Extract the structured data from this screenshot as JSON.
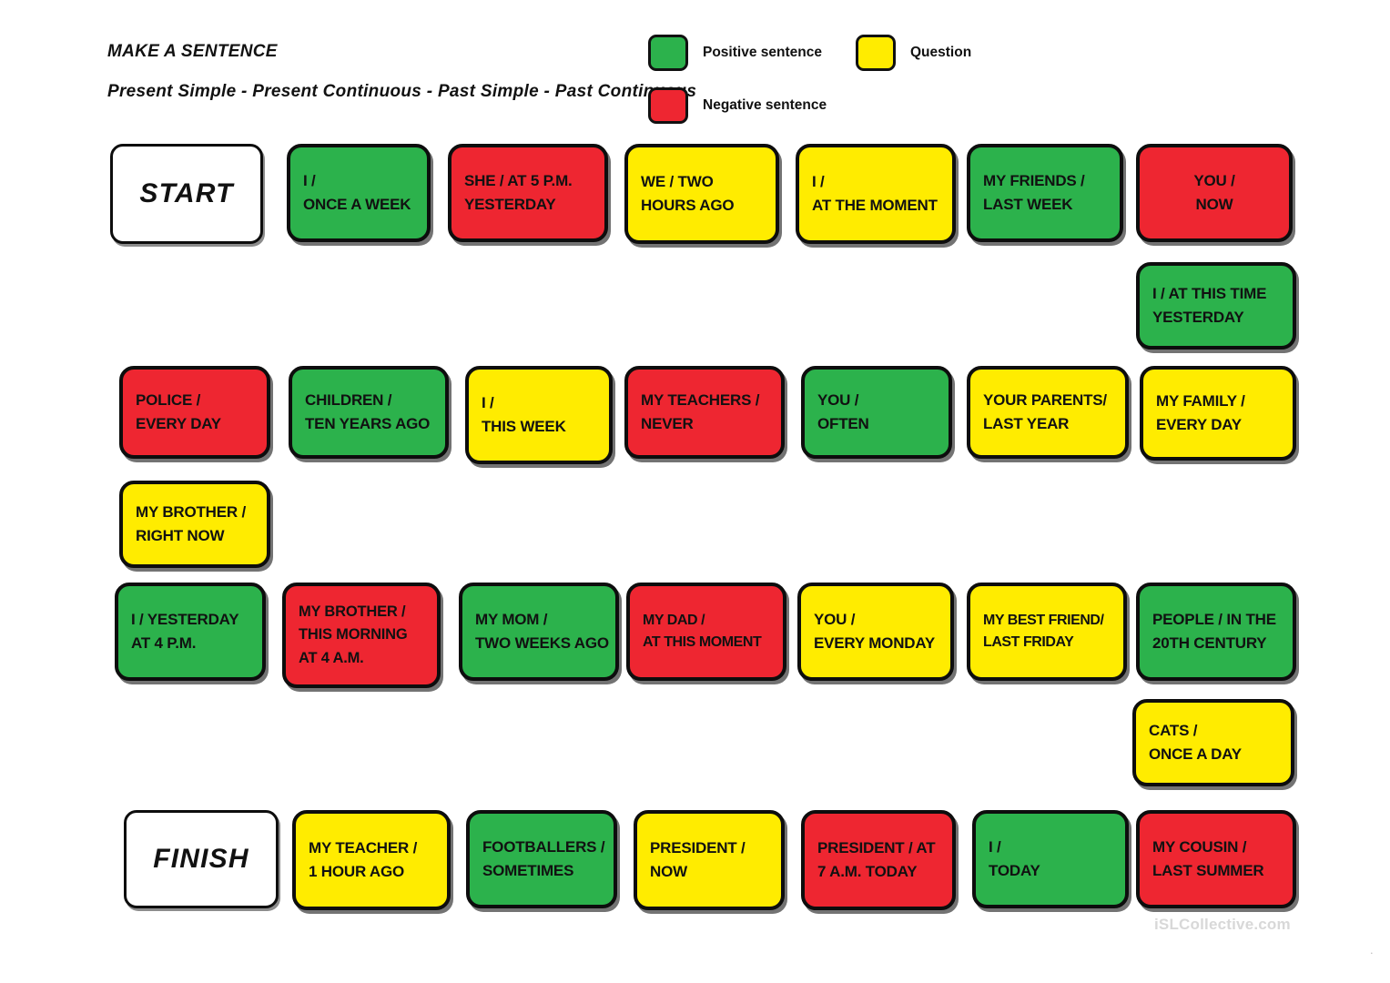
{
  "header": {
    "title": "MAKE A SENTENCE",
    "subtitle": "Present Simple - Present Continuous - Past Simple - Past Continuous"
  },
  "legend": {
    "positive": {
      "label": "Positive sentence",
      "color": "#2cb24c"
    },
    "negative": {
      "label": "Negative sentence",
      "color": "#ee2631"
    },
    "question": {
      "label": "Question",
      "color": "#ffec00"
    }
  },
  "colors": {
    "green": "#2cb24c",
    "red": "#ee2631",
    "yellow": "#ffec00",
    "white": "#ffffff",
    "outline": "#0d0d0d",
    "watermark": "#d8d8d8"
  },
  "board": {
    "cards": [
      {
        "id": "start",
        "type": "white",
        "lines": [
          "START"
        ]
      },
      {
        "id": "r1c2",
        "type": "green",
        "lines": [
          "I /",
          "ONCE A WEEK"
        ]
      },
      {
        "id": "r1c3",
        "type": "red",
        "lines": [
          "SHE / AT 5 P.M.",
          "YESTERDAY"
        ]
      },
      {
        "id": "r1c4",
        "type": "yellow",
        "lines": [
          "WE / TWO",
          "HOURS AGO"
        ]
      },
      {
        "id": "r1c5",
        "type": "yellow",
        "lines": [
          "I /",
          "AT THE MOMENT"
        ]
      },
      {
        "id": "r1c6",
        "type": "green",
        "lines": [
          "MY FRIENDS /",
          "LAST WEEK"
        ]
      },
      {
        "id": "r1c7",
        "type": "red",
        "lines": [
          "YOU /",
          "NOW"
        ]
      },
      {
        "id": "link1",
        "type": "green",
        "lines": [
          "I / AT THIS TIME",
          "YESTERDAY"
        ]
      },
      {
        "id": "r2c1",
        "type": "red",
        "lines": [
          "POLICE /",
          "EVERY DAY"
        ]
      },
      {
        "id": "r2c2",
        "type": "green",
        "lines": [
          "CHILDREN /",
          "TEN YEARS AGO"
        ]
      },
      {
        "id": "r2c3",
        "type": "yellow",
        "lines": [
          "I /",
          "THIS WEEK"
        ]
      },
      {
        "id": "r2c4",
        "type": "red",
        "lines": [
          "MY TEACHERS /",
          "NEVER"
        ]
      },
      {
        "id": "r2c5",
        "type": "green",
        "lines": [
          "YOU /",
          "OFTEN"
        ]
      },
      {
        "id": "r2c6",
        "type": "yellow",
        "lines": [
          "YOUR PARENTS/",
          "LAST YEAR"
        ]
      },
      {
        "id": "r2c7",
        "type": "yellow",
        "lines": [
          "MY FAMILY /",
          "EVERY DAY"
        ]
      },
      {
        "id": "link2",
        "type": "yellow",
        "lines": [
          "MY BROTHER /",
          "RIGHT NOW"
        ]
      },
      {
        "id": "r3c1",
        "type": "green",
        "lines": [
          "I / YESTERDAY",
          "AT 4 P.M."
        ]
      },
      {
        "id": "r3c2",
        "type": "red",
        "lines": [
          "MY BROTHER /",
          "THIS MORNING",
          "AT 4 A.M."
        ]
      },
      {
        "id": "r3c3",
        "type": "green",
        "lines": [
          "MY MOM /",
          "TWO WEEKS AGO"
        ]
      },
      {
        "id": "r3c4",
        "type": "red",
        "lines": [
          "MY DAD /",
          "AT THIS MOMENT"
        ]
      },
      {
        "id": "r3c5",
        "type": "yellow",
        "lines": [
          "YOU /",
          "EVERY MONDAY"
        ]
      },
      {
        "id": "r3c6",
        "type": "yellow",
        "lines": [
          "MY BEST FRIEND/",
          "LAST FRIDAY"
        ]
      },
      {
        "id": "r3c7",
        "type": "green",
        "lines": [
          "PEOPLE / IN THE",
          "20TH CENTURY"
        ]
      },
      {
        "id": "link3",
        "type": "yellow",
        "lines": [
          "CATS /",
          "ONCE A DAY"
        ]
      },
      {
        "id": "finish",
        "type": "white",
        "lines": [
          "FINISH"
        ]
      },
      {
        "id": "r4c2",
        "type": "yellow",
        "lines": [
          "MY TEACHER /",
          "1 HOUR AGO"
        ]
      },
      {
        "id": "r4c3",
        "type": "green",
        "lines": [
          "FOOTBALLERS /",
          "SOMETIMES"
        ]
      },
      {
        "id": "r4c4",
        "type": "yellow",
        "lines": [
          "PRESIDENT /",
          "NOW"
        ]
      },
      {
        "id": "r4c5",
        "type": "red",
        "lines": [
          "PRESIDENT / AT",
          "7 A.M. TODAY"
        ]
      },
      {
        "id": "r4c6",
        "type": "green",
        "lines": [
          "I /",
          "TODAY"
        ]
      },
      {
        "id": "r4c7",
        "type": "red",
        "lines": [
          "MY COUSIN /",
          "LAST SUMMER"
        ]
      }
    ]
  },
  "footer": {
    "watermark": "iSLCollective.com",
    "corner_mark": "."
  }
}
